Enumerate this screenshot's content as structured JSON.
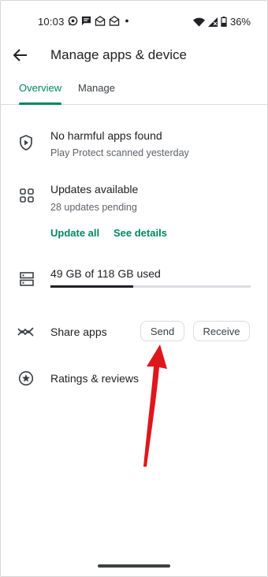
{
  "status_bar": {
    "time": "10:03",
    "battery": "36%",
    "notification_icons": [
      "whatsapp-icon",
      "message-icon",
      "mail-icon",
      "mail-icon",
      "dot-icon"
    ]
  },
  "app_bar": {
    "title": "Manage apps & device"
  },
  "tabs": [
    {
      "label": "Overview",
      "selected": true
    },
    {
      "label": "Manage",
      "selected": false
    }
  ],
  "protect": {
    "title": "No harmful apps found",
    "subtitle": "Play Protect scanned yesterday"
  },
  "updates": {
    "title": "Updates available",
    "subtitle": "28 updates pending",
    "update_all": "Update all",
    "see_details": "See details"
  },
  "storage": {
    "label": "49 GB of 118 GB used",
    "used_fraction": 0.415
  },
  "share": {
    "label": "Share apps",
    "send": "Send",
    "receive": "Receive"
  },
  "ratings": {
    "label": "Ratings & reviews"
  },
  "colors": {
    "accent": "#01875f",
    "arrow": "#e0161d"
  }
}
